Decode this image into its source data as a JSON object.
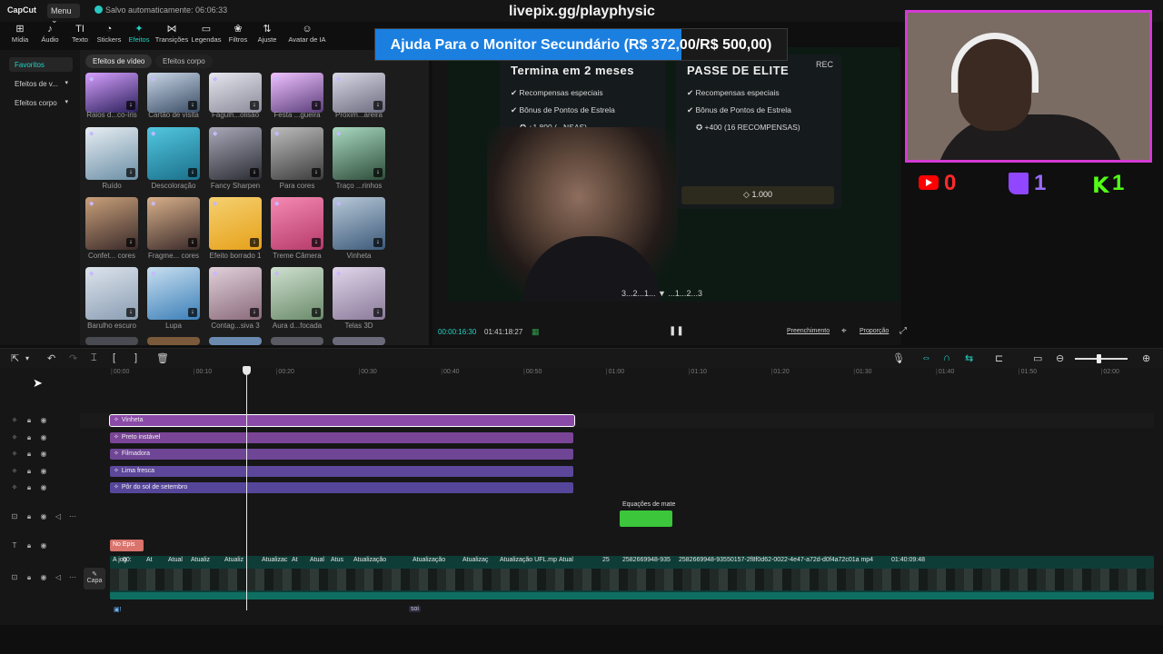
{
  "app": {
    "logo": "CapCut",
    "menu_label": "Menu",
    "autosave_text": "Salvo automaticamente: 06:06:33",
    "stream_url": "livepix.gg/playphysic"
  },
  "toolbar": [
    {
      "icon": "media-icon",
      "glyph": "⊞",
      "label": "Mídia"
    },
    {
      "icon": "audio-icon",
      "glyph": "♪",
      "label": "Áudio"
    },
    {
      "icon": "text-icon",
      "glyph": "TI",
      "label": "Texto"
    },
    {
      "icon": "stickers-icon",
      "glyph": "◔",
      "label": "Stickers"
    },
    {
      "icon": "effects-icon",
      "glyph": "✦",
      "label": "Efeitos",
      "active": true
    },
    {
      "icon": "transitions-icon",
      "glyph": "⋈",
      "label": "Transições"
    },
    {
      "icon": "captions-icon",
      "glyph": "▭",
      "label": "Legendas"
    },
    {
      "icon": "filters-icon",
      "glyph": "❀",
      "label": "Filtros"
    },
    {
      "icon": "adjust-icon",
      "glyph": "⇅",
      "label": "Ajuste"
    },
    {
      "icon": "ai-avatar-icon",
      "glyph": "☺",
      "label": "Avatar de IA"
    }
  ],
  "sidebar": {
    "items": [
      {
        "label": "Favoritos",
        "active": true
      },
      {
        "label": "Efeitos de v...",
        "dropdown": true
      },
      {
        "label": "Efeitos corpo",
        "dropdown": true
      }
    ]
  },
  "effects": {
    "tabs": [
      "Efeitos de vídeo",
      "Efeitos corpo"
    ],
    "items": [
      {
        "label": "Raios d...co-íris",
        "colors": [
          "#2a1f5a",
          "#d6a0ff"
        ]
      },
      {
        "label": "Cartão de visita",
        "colors": [
          "#3a4d66",
          "#c9d6e6"
        ]
      },
      {
        "label": "Fagulh...olisão",
        "colors": [
          "#8a8a9a",
          "#e6e6ee"
        ]
      },
      {
        "label": "Festa ...gueira",
        "colors": [
          "#5a3e7a",
          "#f0c2ff"
        ]
      },
      {
        "label": "Próxim...areira",
        "colors": [
          "#6c6c80",
          "#d8d8e4"
        ]
      },
      {
        "label": "Ruído",
        "colors": [
          "#6b8fa6",
          "#e8eef3"
        ]
      },
      {
        "label": "Descoloração",
        "colors": [
          "#1a6f8a",
          "#53c7e0"
        ]
      },
      {
        "label": "Fancy Sharpen",
        "colors": [
          "#2c2c34",
          "#a8a8b8"
        ]
      },
      {
        "label": "Para cores",
        "colors": [
          "#3c3c3c",
          "#bdbdbd"
        ]
      },
      {
        "label": "Traço ...rinhos",
        "colors": [
          "#2e4d3a",
          "#a9d9c0"
        ]
      },
      {
        "label": "Confet... cores",
        "colors": [
          "#3a2a2a",
          "#c9a07a"
        ]
      },
      {
        "label": "Fragme... cores",
        "colors": [
          "#3a2a2a",
          "#d8b08a"
        ]
      },
      {
        "label": "Efeito borrado 1",
        "colors": [
          "#e6a11a",
          "#f5d070"
        ]
      },
      {
        "label": "Treme Câmera",
        "colors": [
          "#b53a6a",
          "#f58ab3"
        ]
      },
      {
        "label": "Vinheta",
        "colors": [
          "#3d5a7a",
          "#b8c9d8"
        ]
      },
      {
        "label": "Barulho escuro",
        "colors": [
          "#8a9db3",
          "#dde4ec"
        ]
      },
      {
        "label": "Lupa",
        "colors": [
          "#3b7fb8",
          "#c8dff0"
        ]
      },
      {
        "label": "Contag...siva 3",
        "colors": [
          "#8a6a7a",
          "#e0d0da"
        ]
      },
      {
        "label": "Aura d...focada",
        "colors": [
          "#6a8a6a",
          "#cfe0cf"
        ]
      },
      {
        "label": "Telas 3D",
        "colors": [
          "#8a7a9a",
          "#e0d6ea"
        ]
      }
    ]
  },
  "banner": {
    "text": "Ajuda Para o Monitor Secundário (R$ 372,00/R$ 500,00)",
    "progress": 0.744
  },
  "preview": {
    "card_left": {
      "title": "Termina em 2 meses",
      "row1": "Recompensas especiais",
      "row2": "Bônus de Pontos de Estrela",
      "row3": "+1.800 (",
      "row3_tail": "...NSAS)"
    },
    "card_right": {
      "title": "PASSE DE ELITE",
      "row1": "Recompensas especiais",
      "row2": "Bônus de Pontos de Estrela",
      "row3": "+400 (16 RECOMPENSAS)",
      "cost": "1.000"
    },
    "rec_label": "REC",
    "countdown": "3...2...1... ▼ ...1...2...3"
  },
  "player": {
    "current_time": "00:00:16:30",
    "total_time": "01:41:18:27",
    "fill_label": "Preenchimento",
    "ratio_label": "Proporção"
  },
  "stream_counters": [
    {
      "platform": "youtube",
      "icon": "youtube-icon",
      "value": "0",
      "color": "#ff2a2a"
    },
    {
      "platform": "twitch",
      "icon": "twitch-icon",
      "value": "1",
      "color": "#9b6bff"
    },
    {
      "platform": "kick",
      "icon": "kick-icon",
      "value": "1",
      "color": "#53fc18"
    }
  ],
  "timeline": {
    "ruler": [
      "00:00",
      "00:10",
      "00:20",
      "00:30",
      "00:40",
      "00:50",
      "01:00",
      "01:10",
      "01:20",
      "01:30",
      "01:40",
      "01:50",
      "02:00"
    ],
    "effect_clips": [
      {
        "label": "Vinheta",
        "color": "#8a4aa8"
      },
      {
        "label": "Preto instável",
        "color": "#7a4596"
      },
      {
        "label": "Filmadora",
        "color": "#6f4596"
      },
      {
        "label": "Lima fresca",
        "color": "#5c479a"
      },
      {
        "label": "Pôr do sol de setembro",
        "color": "#56469a"
      }
    ],
    "sticker_title": "Equações de mate",
    "text_clip": "No Epis",
    "video_labels": [
      "A jog",
      "00:",
      "At",
      "Atual",
      "Atualiz",
      "Atualiz",
      "Atualizac",
      "At",
      "Atual",
      "Atus",
      "Atualização",
      "Atualização",
      "Atualizaç",
      "Atualização UFL.mp",
      "Atual",
      "25",
      "2582669948-935",
      "2582669948-93550157-2f8f0d62-0022-4e47-a72d-d0f4a72c01a mp4",
      "01:40:09:48"
    ],
    "capa_label": "Capa",
    "footer_badge": "soi"
  }
}
